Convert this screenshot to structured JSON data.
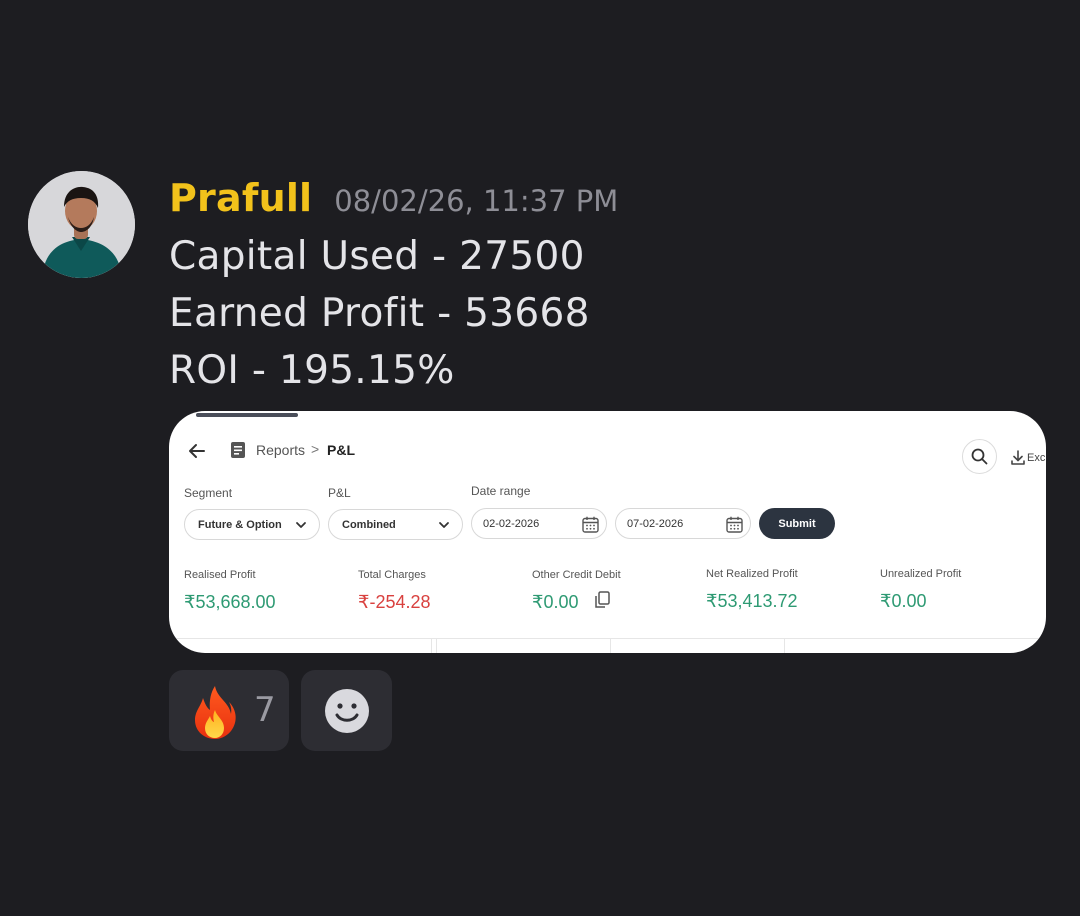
{
  "message": {
    "author": "Prafull",
    "timestamp": "08/02/26, 11:37 PM",
    "lines": [
      "Capital Used  - 27500",
      "Earned Profit - 53668",
      "ROI - 195.15%"
    ]
  },
  "screenshot": {
    "breadcrumb": {
      "section": "Reports",
      "separator": ">",
      "page": "P&L"
    },
    "excel_label": "Exc",
    "filters": {
      "segment_label": "Segment",
      "segment_value": "Future & Option",
      "pl_label": "P&L",
      "pl_value": "Combined",
      "date_label": "Date range",
      "date_from": "02-02-2026",
      "date_to": "07-02-2026",
      "submit_label": "Submit"
    },
    "stats": [
      {
        "label": "Realised Profit",
        "value": "₹53,668.00"
      },
      {
        "label": "Total Charges",
        "value": "₹-254.28"
      },
      {
        "label": "Other Credit Debit",
        "value": "₹0.00"
      },
      {
        "label": "Net Realized Profit",
        "value": "₹53,413.72"
      },
      {
        "label": "Unrealized Profit",
        "value": "₹0.00"
      }
    ],
    "colors": {
      "profit": "#2e9a73",
      "loss": "#d9413f",
      "submit_bg": "#2c3440"
    }
  },
  "reactions": [
    {
      "icon": "fire-emoji",
      "count": "7"
    },
    {
      "icon": "add-reaction-icon"
    }
  ],
  "colors": {
    "author": "#f2c21b",
    "background": "#1d1d21"
  }
}
